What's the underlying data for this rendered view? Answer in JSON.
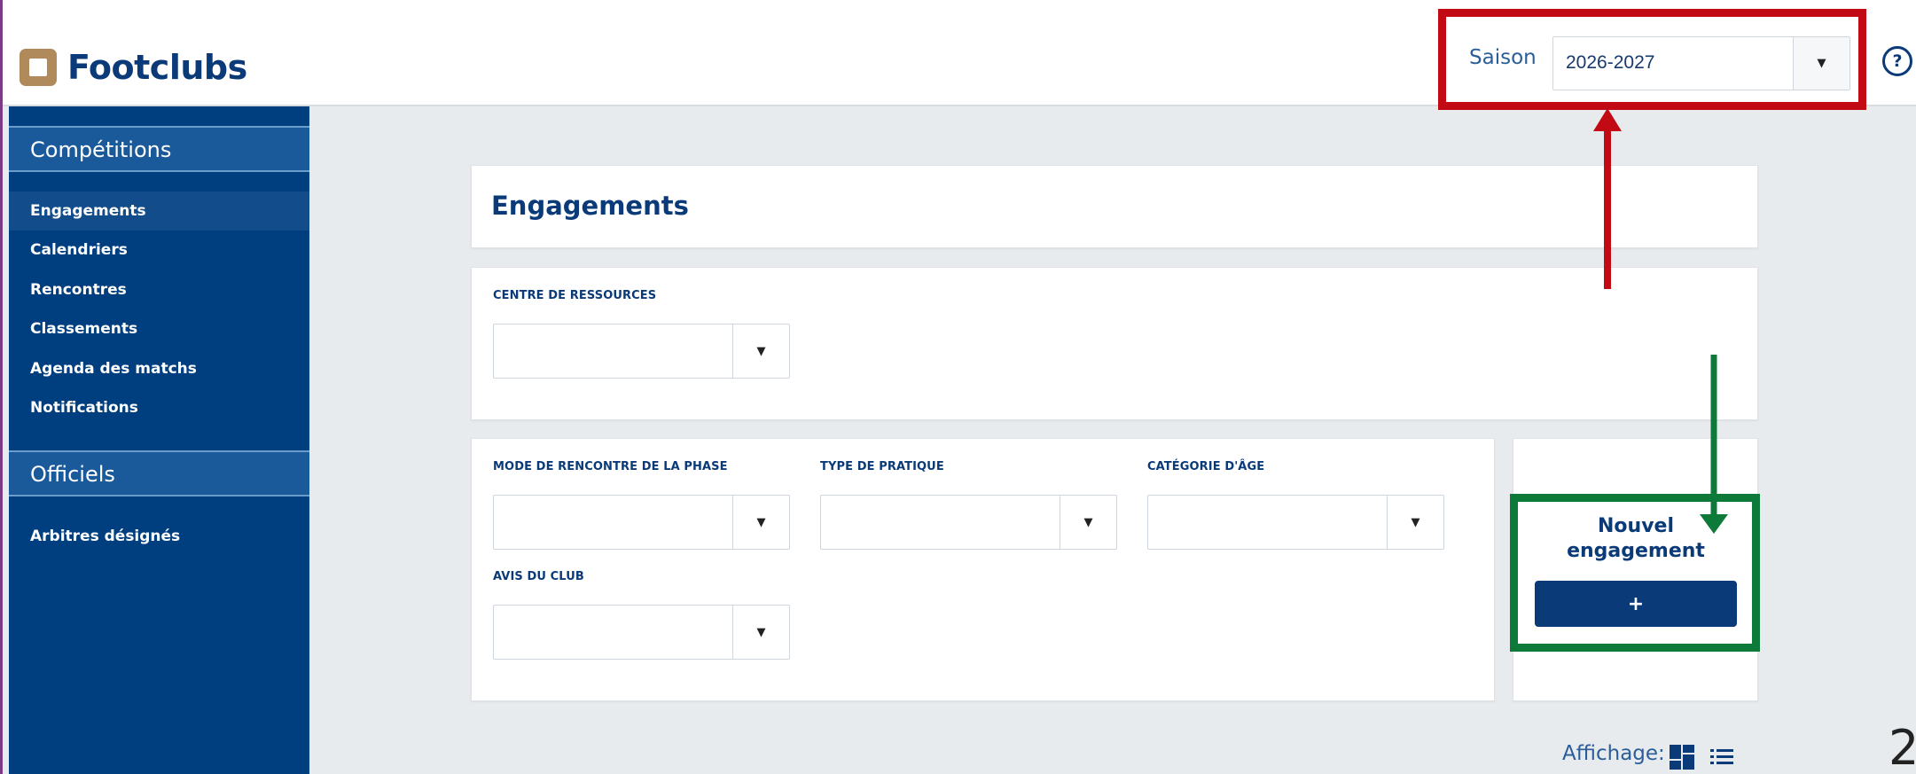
{
  "app": {
    "name": "Footclubs"
  },
  "header": {
    "season_label": "Saison",
    "season_value": "2026-2027",
    "help_label": "?"
  },
  "sidebar": {
    "sections": [
      {
        "title": "Compétitions",
        "items": [
          "Engagements",
          "Calendriers",
          "Rencontres",
          "Classements",
          "Agenda des matchs",
          "Notifications"
        ]
      },
      {
        "title": "Officiels",
        "items": [
          "Arbitres désignés"
        ]
      }
    ],
    "active_item": "Engagements"
  },
  "main": {
    "title": "Engagements",
    "filters": {
      "centre_label": "CENTRE DE RESSOURCES",
      "mode_label": "MODE DE RENCONTRE DE LA PHASE",
      "type_label": "TYPE DE PRATIQUE",
      "categorie_label": "CATÉGORIE D'ÂGE",
      "avis_label": "AVIS DU CLUB"
    },
    "nouvel_engagement": {
      "title_line1": "Nouvel",
      "title_line2": "engagement",
      "button_label": "+"
    },
    "affichage_label": "Affichage:"
  },
  "page_number": "2",
  "colors": {
    "annotation_red": "#c20a14",
    "annotation_green": "#0d7a3a",
    "brand_blue": "#003f7f",
    "logo_gold": "#b08a5a"
  }
}
